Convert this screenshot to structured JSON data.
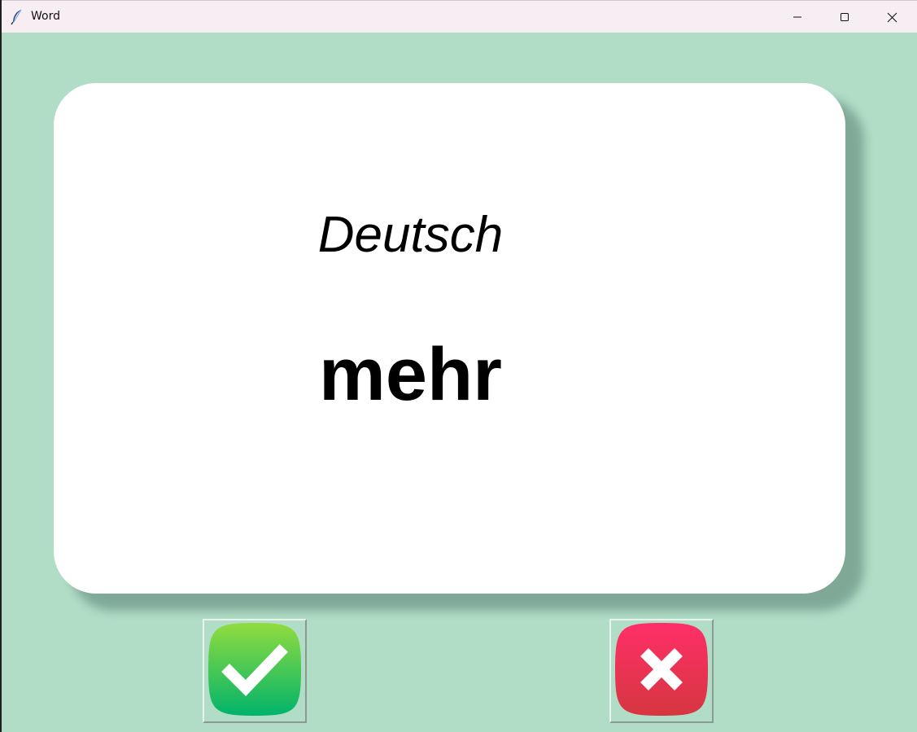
{
  "window": {
    "title": "Word",
    "app_icon": "feather-icon",
    "controls": [
      "minimize-icon",
      "maximize-icon",
      "close-icon"
    ]
  },
  "card": {
    "language": "Deutsch",
    "word": "mehr"
  },
  "buttons": {
    "right": {
      "icon": "checkmark-icon",
      "color": "#22c55e"
    },
    "wrong": {
      "icon": "cross-icon",
      "color": "#ef3358"
    }
  },
  "colors": {
    "background": "#b1ddc6",
    "card": "#ffffff",
    "titlebar": "#f7eef3"
  }
}
